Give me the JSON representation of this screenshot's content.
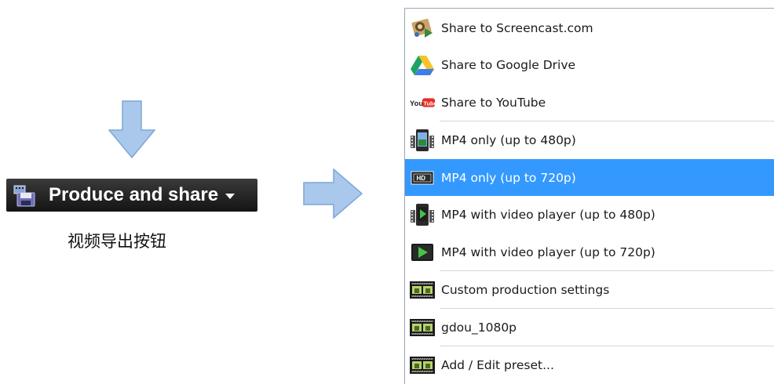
{
  "left": {
    "button_label": "Produce and share",
    "caption": "视频导出按钮",
    "icons": {
      "button_icon": "film-save-icon",
      "dropdown": "caret-down-icon",
      "down_arrow": "down-arrow-icon",
      "right_arrow": "right-arrow-icon"
    },
    "colors": {
      "arrow_fill": "#a9c8ec",
      "arrow_stroke": "#7ea6d6",
      "button_bg": "#1f1f1f"
    }
  },
  "menu": {
    "items": [
      {
        "label": "Share to Screencast.com",
        "icon": "screencast-icon"
      },
      {
        "label": "Share to Google Drive",
        "icon": "google-drive-icon"
      },
      {
        "label": "Share to YouTube",
        "icon": "youtube-icon"
      },
      {
        "label": "MP4 only (up to 480p)",
        "icon": "phone-video-icon"
      },
      {
        "label": "MP4 only (up to 720p)",
        "icon": "hd-icon",
        "selected": true
      },
      {
        "label": "MP4 with video player (up to 480p)",
        "icon": "phone-player-icon"
      },
      {
        "label": "MP4 with video player (up to 720p)",
        "icon": "play-icon"
      },
      {
        "label": "Custom production settings",
        "icon": "film-strip-icon"
      },
      {
        "label": "gdou_1080p",
        "icon": "film-strip-icon"
      },
      {
        "label": "Add / Edit preset...",
        "icon": "film-strip-icon"
      }
    ],
    "colors": {
      "selected_bg": "#3399ff",
      "separator": "#d6d6d6"
    }
  }
}
